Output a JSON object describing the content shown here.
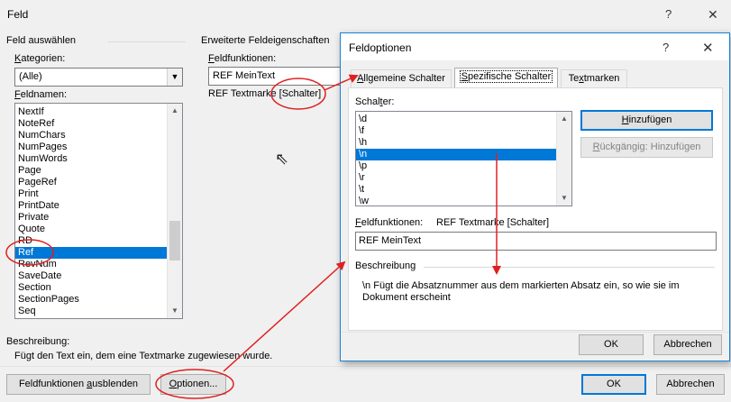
{
  "main": {
    "title": "Feld",
    "help_icon": "?",
    "close_icon": "✕",
    "select_field_group": "Feld auswählen",
    "categories_label": "Kategorien:",
    "categories_value": "(Alle)",
    "fieldnames_label": "Feldnamen:",
    "fieldnames": [
      "NextIf",
      "NoteRef",
      "NumChars",
      "NumPages",
      "NumWords",
      "Page",
      "PageRef",
      "Print",
      "PrintDate",
      "Private",
      "Quote",
      "RD",
      "Ref",
      "RevNum",
      "SaveDate",
      "Section",
      "SectionPages",
      "Seq"
    ],
    "selected_fieldname": "Ref",
    "advanced_group": "Erweiterte Feldeigenschaften",
    "field_codes_label": "Feldfunktionen:",
    "field_codes_value": "REF  MeinText",
    "field_codes_syntax_prefix": "REF Textmarke ",
    "field_codes_syntax_switch": "[Schalter]",
    "description_label": "Beschreibung:",
    "description_text": "Fügt den Text ein, dem eine Textmarke zugewiesen wurde.",
    "hide_codes_button": "Feldfunktionen ausblenden",
    "options_button": "Optionen...",
    "ok_button": "OK",
    "cancel_button": "Abbrechen"
  },
  "options": {
    "title": "Feldoptionen",
    "help_icon": "?",
    "close_icon": "✕",
    "tabs": [
      "Allgemeine Schalter",
      "Spezifische Schalter",
      "Textmarken"
    ],
    "active_tab": "Spezifische Schalter",
    "switches_label": "Schalter:",
    "switches": [
      "\\d",
      "\\f",
      "\\h",
      "\\n",
      "\\p",
      "\\r",
      "\\t",
      "\\w"
    ],
    "selected_switch": "\\n",
    "add_button": "Hinzufügen",
    "undo_add_button": "Rückgängig: Hinzufügen",
    "field_codes_label": "Feldfunktionen:",
    "field_codes_syntax": "REF Textmarke [Schalter]",
    "field_codes_value": "REF  MeinText",
    "description_label": "Beschreibung",
    "description_line1": "\\n Fügt die Absatznummer aus dem markierten Absatz ein, so wie sie im",
    "description_line2": "Dokument erscheint",
    "ok_button": "OK",
    "cancel_button": "Abbrechen"
  },
  "annotation_color": "#e02020",
  "accent_color": "#0078d7"
}
